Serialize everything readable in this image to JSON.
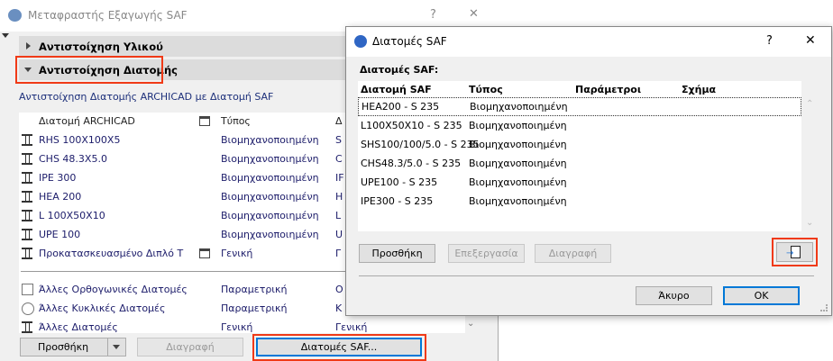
{
  "main_window": {
    "title": "Μεταφραστής Εξαγωγής SAF",
    "help": "?",
    "close": "✕",
    "section_material": "Αντιστοίχηση Υλικού",
    "section_profile": "Αντιστοίχηση Διατομής",
    "subtitle": "Αντιστοίχηση Διατομής ARCHICAD με Διατομή SAF",
    "columns": [
      "Διατομή ARCHICAD",
      "Τύπος",
      "Δ"
    ],
    "rows": [
      {
        "name": "RHS 100X100X5",
        "type": "Βιομηχανοποιημένη",
        "saf": "S",
        "icon": "i-beam-icon"
      },
      {
        "name": "CHS 48.3X5.0",
        "type": "Βιομηχανοποιημένη",
        "saf": "C",
        "icon": "i-beam-icon"
      },
      {
        "name": "IPE 300",
        "type": "Βιομηχανοποιημένη",
        "saf": "IF",
        "icon": "i-beam-icon"
      },
      {
        "name": "HEA 200",
        "type": "Βιομηχανοποιημένη",
        "saf": "H",
        "icon": "i-beam-icon"
      },
      {
        "name": "L 100X50X10",
        "type": "Βιομηχανοποιημένη",
        "saf": "L",
        "icon": "i-beam-icon"
      },
      {
        "name": "UPE 100",
        "type": "Βιομηχανοποιημένη",
        "saf": "U",
        "icon": "i-beam-icon"
      },
      {
        "name": "Προκατασκευασμένο Διπλό Τ",
        "type": "Γενική",
        "saf": "Γ",
        "icon": "i-beam-icon",
        "flag": true
      }
    ],
    "other_rows": [
      {
        "name": "Άλλες Ορθογωνικές Διατομές",
        "type": "Παραμετρική",
        "saf": "O",
        "icon": "rectangle-icon"
      },
      {
        "name": "Άλλες Κυκλικές Διατομές",
        "type": "Παραμετρική",
        "saf": "K",
        "icon": "circle-icon"
      },
      {
        "name": "Άλλες Διατομές",
        "type": "Γενική",
        "saf": "Γενική",
        "icon": "i-beam-icon"
      }
    ],
    "add_label": "Προσθήκη",
    "delete_label": "Διαγραφή",
    "saf_profiles_label": "Διατομές SAF..."
  },
  "dialog": {
    "title": "Διατομές SAF",
    "help": "?",
    "close": "✕",
    "list_label": "Διατομές SAF:",
    "columns": [
      "Διατομή SAF",
      "Τύπος",
      "Παράμετροι",
      "Σχήμα"
    ],
    "rows": [
      {
        "name": "HEA200 - S 235",
        "type": "Βιομηχανοποιημένη"
      },
      {
        "name": "L100X50X10 - S 235",
        "type": "Βιομηχανοποιημένη"
      },
      {
        "name": "SHS100/100/5.0 - S 235",
        "type": "Βιομηχανοποιημένη"
      },
      {
        "name": "CHS48.3/5.0 - S 235",
        "type": "Βιομηχανοποιημένη"
      },
      {
        "name": "UPE100 - S 235",
        "type": "Βιομηχανοποιημένη"
      },
      {
        "name": "IPE300 - S 235",
        "type": "Βιομηχανοποιημένη"
      }
    ],
    "add_label": "Προσθήκη",
    "edit_label": "Επεξεργασία",
    "delete_label": "Διαγραφή",
    "cancel_label": "Άκυρο",
    "ok_label": "OK"
  },
  "colors": {
    "highlight": "#f03a17",
    "focus": "#0078d7"
  }
}
